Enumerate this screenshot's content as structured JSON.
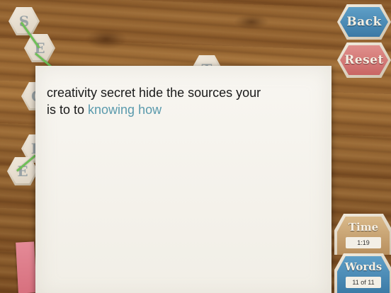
{
  "board": {
    "tiles": [
      {
        "letter": "S"
      },
      {
        "letter": "E"
      },
      {
        "letter": "C"
      },
      {
        "letter": "R"
      },
      {
        "letter": "E"
      },
      {
        "letter": "T"
      }
    ]
  },
  "puzzle": {
    "line1": [
      {
        "text": "creativity",
        "hint": false
      },
      {
        "text": "secret",
        "hint": false
      },
      {
        "text": "hide",
        "hint": false
      },
      {
        "text": "the",
        "hint": false
      },
      {
        "text": "sources",
        "hint": false
      },
      {
        "text": "your",
        "hint": false
      }
    ],
    "line2": [
      {
        "text": "is",
        "hint": false
      },
      {
        "text": "to",
        "hint": false
      },
      {
        "text": "to",
        "hint": false
      },
      {
        "text": "knowing",
        "hint": true
      },
      {
        "text": "how",
        "hint": true
      }
    ],
    "hint_color": "#5a9aac"
  },
  "buttons": {
    "back_label": "Back",
    "reset_label": "Reset"
  },
  "time": {
    "label": "Time",
    "value": "1:19"
  },
  "words": {
    "label": "Words",
    "value": "11 of 11"
  },
  "colors": {
    "back_button": "#4a88b5",
    "reset_button": "#d37977",
    "path_line": "#6fbf57"
  }
}
